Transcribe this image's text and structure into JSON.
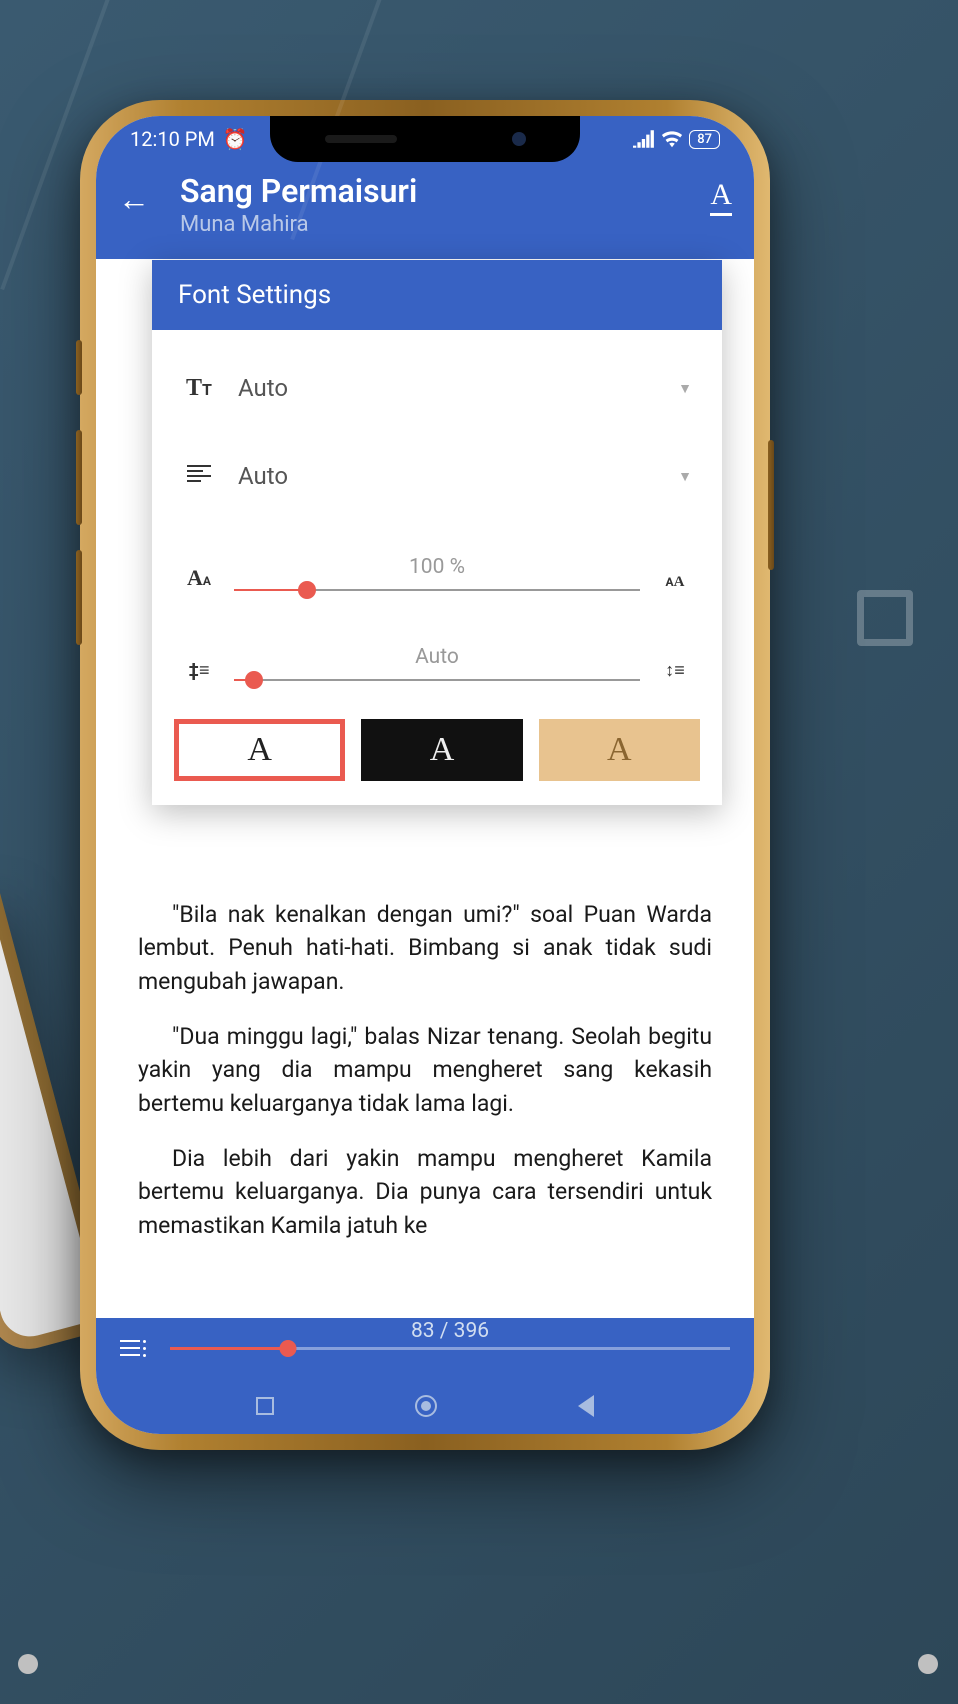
{
  "status": {
    "time": "12:10 PM",
    "battery": "87"
  },
  "appbar": {
    "title": "Sang Permaisuri",
    "author": "Muna Mahira"
  },
  "panel": {
    "heading": "Font Settings",
    "font_family": {
      "label": "Auto"
    },
    "alignment": {
      "label": "Auto"
    },
    "font_size": {
      "label": "100 %",
      "percent": 18
    },
    "line_spacing": {
      "label": "Auto",
      "percent": 5
    },
    "themes": {
      "light": "A",
      "dark": "A",
      "sepia": "A"
    }
  },
  "reader": {
    "p1": "\"Bila nak kenalkan dengan umi?\" soal Puan Warda lembut. Penuh hati-hati. Bimbang si anak tidak sudi mengubah jawapan.",
    "p2": "\"Dua minggu lagi,\" balas Nizar tenang. Seolah begitu yakin yang dia mampu mengheret sang kekasih bertemu keluarganya tidak lama lagi.",
    "p3": "Dia lebih dari yakin mampu mengheret Kamila bertemu keluarganya. Dia punya cara tersendiri untuk memastikan Kamila jatuh ke"
  },
  "footer": {
    "pages": "83 / 396",
    "progress": 21
  }
}
